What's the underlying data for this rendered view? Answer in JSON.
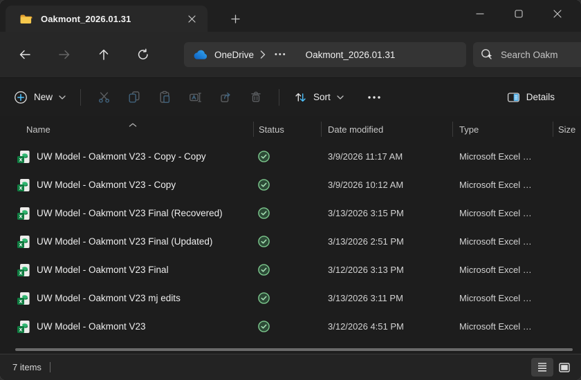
{
  "window": {
    "tab": {
      "title": "Oakmont_2026.01.31"
    },
    "statusbar": {
      "items_count": "7 items"
    }
  },
  "navigation": {
    "breadcrumb": {
      "root": "OneDrive",
      "ellipsis": "•••",
      "current": "Oakmont_2026.01.31"
    },
    "search": {
      "placeholder": "Search Oakm"
    }
  },
  "toolbar": {
    "new_label": "New",
    "sort_label": "Sort",
    "details_label": "Details"
  },
  "table": {
    "columns": {
      "name": "Name",
      "status": "Status",
      "date_modified": "Date modified",
      "type": "Type",
      "size": "Size"
    },
    "sort_indicator_column": "Name",
    "files": [
      {
        "name": "UW Model - Oakmont V23 - Copy - Copy",
        "status": "synced",
        "date_modified": "3/9/2026 11:17 AM",
        "type": "Microsoft Excel …",
        "size": ""
      },
      {
        "name": "UW Model - Oakmont V23 - Copy",
        "status": "synced",
        "date_modified": "3/9/2026 10:12 AM",
        "type": "Microsoft Excel …",
        "size": ""
      },
      {
        "name": "UW Model - Oakmont V23 Final (Recovered)",
        "status": "synced",
        "date_modified": "3/13/2026 3:15 PM",
        "type": "Microsoft Excel …",
        "size": ""
      },
      {
        "name": "UW Model - Oakmont V23 Final (Updated)",
        "status": "synced",
        "date_modified": "3/13/2026 2:51 PM",
        "type": "Microsoft Excel …",
        "size": ""
      },
      {
        "name": "UW Model - Oakmont V23 Final",
        "status": "synced",
        "date_modified": "3/12/2026 3:13 PM",
        "type": "Microsoft Excel …",
        "size": ""
      },
      {
        "name": "UW Model - Oakmont V23 mj edits",
        "status": "synced",
        "date_modified": "3/13/2026 3:11 PM",
        "type": "Microsoft Excel …",
        "size": ""
      },
      {
        "name": "UW Model - Oakmont V23",
        "status": "synced",
        "date_modified": "3/12/2026 4:51 PM",
        "type": "Microsoft Excel …",
        "size": ""
      }
    ]
  },
  "icons": {
    "folder-icon": "yellow folder",
    "close-tab-icon": "✕",
    "new-tab-icon": "+",
    "minimize-icon": "—",
    "maximize-icon": "□",
    "close-window-icon": "✕",
    "back-icon": "←",
    "forward-icon": "→",
    "up-icon": "↑",
    "refresh-icon": "⟳",
    "onedrive-cloud-icon": "blue cloud",
    "breadcrumb-chevron-icon": "›",
    "search-sparkle-icon": "magnifier with sparkle",
    "new-plus-icon": "⊕",
    "chevron-down-icon": "⌄",
    "cut-icon": "scissors",
    "copy-icon": "two pages",
    "paste-icon": "clipboard",
    "rename-icon": "A with cursor",
    "share-icon": "page with arrow",
    "delete-icon": "trash can",
    "sort-arrows-icon": "↑↓",
    "more-options-icon": "•••",
    "details-pane-icon": "split panel",
    "sort-ascending-caret": "∧",
    "excel-file-icon": "Excel workbook",
    "sync-status-icon": "green check circle",
    "view-details-icon": "list lines",
    "view-thumbnail-icon": "framed square"
  },
  "colors": {
    "accent_blue": "#4cc2ff",
    "excel_green": "#107c41",
    "sync_green": "#7dc98e",
    "folder_yellow": "#f6c84c",
    "window_bg": "#1d1d1d"
  }
}
